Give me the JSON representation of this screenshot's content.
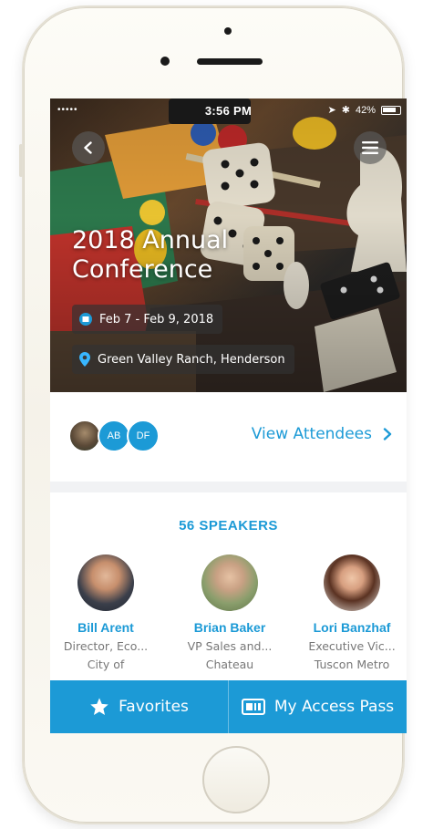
{
  "status": {
    "carrier": "•••••",
    "time": "3:56 PM",
    "battery": "42%"
  },
  "event": {
    "title": "2018 Annual Conference",
    "dates": "Feb 7 - Feb 9, 2018",
    "location": "Green Valley Ranch, Henderson"
  },
  "attendees": {
    "avatars": [
      "AB",
      "DF"
    ],
    "link_label": "View Attendees"
  },
  "speakers": {
    "heading": "56 SPEAKERS",
    "items": [
      {
        "name": "Bill Arent",
        "role": "Director, Eco...",
        "org": "City of"
      },
      {
        "name": "Brian Baker",
        "role": "VP Sales and...",
        "org": "Chateau"
      },
      {
        "name": "Lori Banzhaf",
        "role": "Executive Vic...",
        "org": "Tuscon Metro"
      }
    ]
  },
  "bottom_bar": {
    "favorites_label": "Favorites",
    "access_pass_label": "My Access Pass"
  },
  "colors": {
    "accent": "#1c9ad6",
    "muted_text": "#777777",
    "phone_body": "#f7f4ec"
  },
  "icons": {
    "back": "chevron-left-icon",
    "menu": "hamburger-menu-icon",
    "calendar": "calendar-icon",
    "location": "map-pin-icon",
    "chevron": "chevron-right-icon",
    "favorites": "star-icon",
    "access_pass": "ticket-icon"
  }
}
